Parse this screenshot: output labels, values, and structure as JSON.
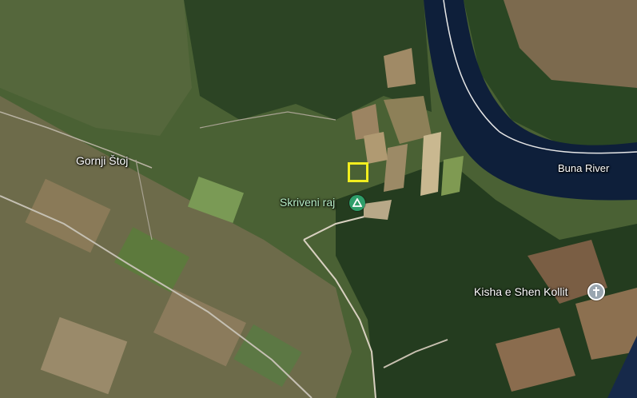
{
  "map": {
    "type": "satellite",
    "labels": {
      "village": "Gornji Štoj",
      "campsite": "Skriveni raj",
      "river": "Buna River",
      "church": "Kisha e Shen Kollit"
    },
    "icons": {
      "campsite": "campsite-triangle-icon",
      "church": "church-cross-icon"
    },
    "colors": {
      "river": "#0e1f3a",
      "riverbank": "#e7e7e7",
      "campsite_marker": "#2e9e6a",
      "church_marker": "#9aa6b0",
      "selection": "#f2ee1f"
    }
  }
}
